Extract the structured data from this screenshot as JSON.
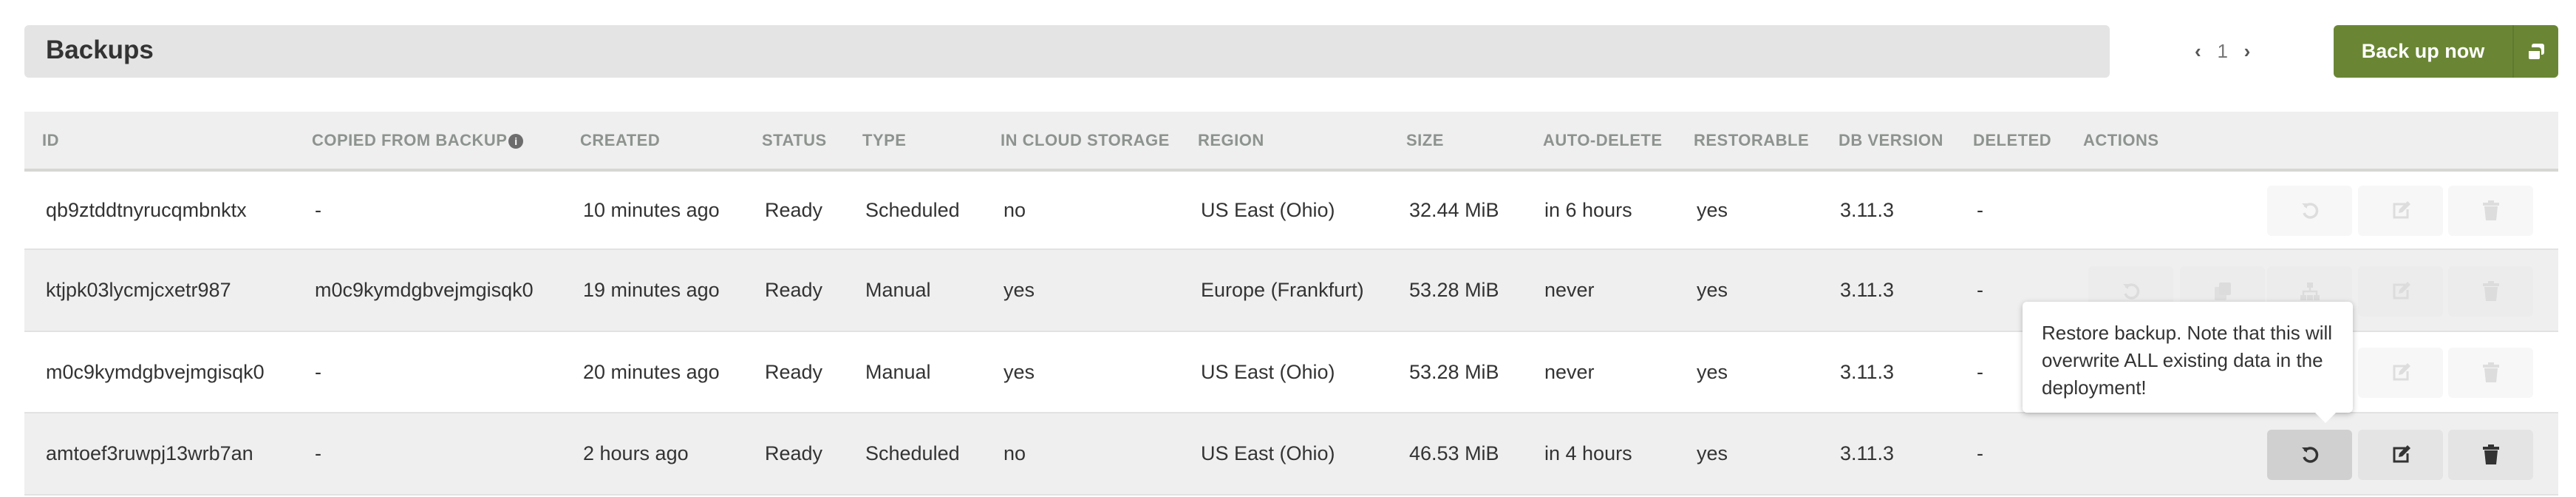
{
  "header": {
    "title": "Backups",
    "page": "1",
    "prev_icon": "chevron-left-icon",
    "next_icon": "chevron-right-icon"
  },
  "backup_button": {
    "label": "Back up now",
    "icon": "copy-icon",
    "color": "#6a8634"
  },
  "table": {
    "columns": [
      "ID",
      "COPIED FROM BACKUP",
      "CREATED",
      "STATUS",
      "TYPE",
      "IN CLOUD STORAGE",
      "REGION",
      "SIZE",
      "AUTO-DELETE",
      "RESTORABLE",
      "DB VERSION",
      "DELETED",
      "ACTIONS"
    ],
    "info_icon": "info-icon",
    "rows": [
      {
        "id": "qb9ztddtnyrucqmbnktx",
        "copied": "-",
        "created": "10 minutes ago",
        "status": "Ready",
        "type": "Scheduled",
        "cloud": "no",
        "region": "US East (Ohio)",
        "size": "32.44 MiB",
        "auto_delete": "in 6 hours",
        "restorable": "yes",
        "db_version": "3.11.3",
        "deleted": "-",
        "actions_enabled": false
      },
      {
        "id": "ktjpk03lycmjcxetr987",
        "copied": "m0c9kymdgbvejmgisqk0",
        "created": "19 minutes ago",
        "status": "Ready",
        "type": "Manual",
        "cloud": "yes",
        "region": "Europe (Frankfurt)",
        "size": "53.28 MiB",
        "auto_delete": "never",
        "restorable": "yes",
        "db_version": "3.11.3",
        "deleted": "-",
        "actions_enabled": false
      },
      {
        "id": "m0c9kymdgbvejmgisqk0",
        "copied": "-",
        "created": "20 minutes ago",
        "status": "Ready",
        "type": "Manual",
        "cloud": "yes",
        "region": "US East (Ohio)",
        "size": "53.28 MiB",
        "auto_delete": "never",
        "restorable": "yes",
        "db_version": "3.11.3",
        "deleted": "-",
        "actions_enabled": false
      },
      {
        "id": "amtoef3ruwpj13wrb7an",
        "copied": "-",
        "created": "2 hours ago",
        "status": "Ready",
        "type": "Scheduled",
        "cloud": "no",
        "region": "US East (Ohio)",
        "size": "46.53 MiB",
        "auto_delete": "in 4 hours",
        "restorable": "yes",
        "db_version": "3.11.3",
        "deleted": "-",
        "actions_enabled": true
      }
    ]
  },
  "tooltip": {
    "text": "Restore backup. Note that this will overwrite ALL existing data in the deployment!"
  }
}
